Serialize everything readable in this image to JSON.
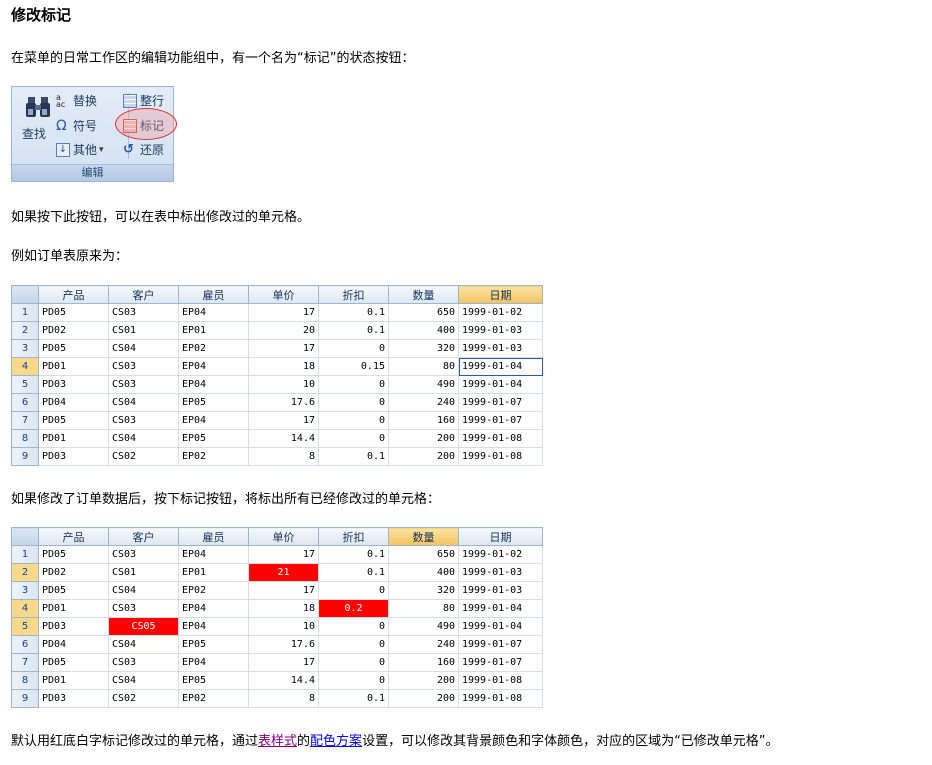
{
  "title": "修改标记",
  "intro": "在菜单的日常工作区的编辑功能组中，有一个名为“标记”的状态按钮：",
  "ribbon": {
    "find": "查找",
    "replace": "替换",
    "symbol": "符号",
    "other": "其他",
    "other_arrow": "▾",
    "tidy": "整行",
    "mark": "标记",
    "restore": "还原",
    "group": "编辑"
  },
  "p_press": "如果按下此按钮，可以在表中标出修改过的单元格。",
  "p_example": "例如订单表原来为：",
  "p_after": "如果修改了订单数据后，按下标记按钮，将标出所有已经修改过的单元格：",
  "p_default": {
    "pre": "默认用红底白字标记修改过的单元格，通过",
    "link1": "表样式",
    "mid": "的",
    "link2": "配色方案",
    "post": "设置，可以修改其背景颜色和字体颜色，对应的区域为“已修改单元格”。"
  },
  "columns": [
    "产品",
    "客户",
    "雇员",
    "单价",
    "折扣",
    "数量",
    "日期"
  ],
  "table1": [
    [
      "1",
      "PD05",
      "CS03",
      "EP04",
      "17",
      "0.1",
      "650",
      "1999-01-02"
    ],
    [
      "2",
      "PD02",
      "CS01",
      "EP01",
      "20",
      "0.1",
      "400",
      "1999-01-03"
    ],
    [
      "3",
      "PD05",
      "CS04",
      "EP02",
      "17",
      "0",
      "320",
      "1999-01-03"
    ],
    [
      "4",
      "PD01",
      "CS03",
      "EP04",
      "18",
      "0.15",
      "80",
      "1999-01-04"
    ],
    [
      "5",
      "PD03",
      "CS03",
      "EP04",
      "10",
      "0",
      "490",
      "1999-01-04"
    ],
    [
      "6",
      "PD04",
      "CS04",
      "EP05",
      "17.6",
      "0",
      "240",
      "1999-01-07"
    ],
    [
      "7",
      "PD05",
      "CS03",
      "EP04",
      "17",
      "0",
      "160",
      "1999-01-07"
    ],
    [
      "8",
      "PD01",
      "CS04",
      "EP05",
      "14.4",
      "0",
      "200",
      "1999-01-08"
    ],
    [
      "9",
      "PD03",
      "CS02",
      "EP02",
      "8",
      "0.1",
      "200",
      "1999-01-08"
    ]
  ],
  "table2": [
    [
      "1",
      "PD05",
      "CS03",
      "EP04",
      "17",
      "0.1",
      "650",
      "1999-01-02"
    ],
    [
      "2",
      "PD02",
      "CS01",
      "EP01",
      "21",
      "0.1",
      "400",
      "1999-01-03"
    ],
    [
      "3",
      "PD05",
      "CS04",
      "EP02",
      "17",
      "0",
      "320",
      "1999-01-03"
    ],
    [
      "4",
      "PD01",
      "CS03",
      "EP04",
      "18",
      "0.2",
      "80",
      "1999-01-04"
    ],
    [
      "5",
      "PD03",
      "CS05",
      "EP04",
      "10",
      "0",
      "490",
      "1999-01-04"
    ],
    [
      "6",
      "PD04",
      "CS04",
      "EP05",
      "17.6",
      "0",
      "240",
      "1999-01-07"
    ],
    [
      "7",
      "PD05",
      "CS03",
      "EP04",
      "17",
      "0",
      "160",
      "1999-01-07"
    ],
    [
      "8",
      "PD01",
      "CS04",
      "EP05",
      "14.4",
      "0",
      "200",
      "1999-01-08"
    ],
    [
      "9",
      "PD03",
      "CS02",
      "EP02",
      "8",
      "0.1",
      "200",
      "1999-01-08"
    ]
  ],
  "colors": {
    "modified_bg": "#ff0000",
    "modified_fg": "#ffffff",
    "header_highlight": "#f4c35f"
  }
}
